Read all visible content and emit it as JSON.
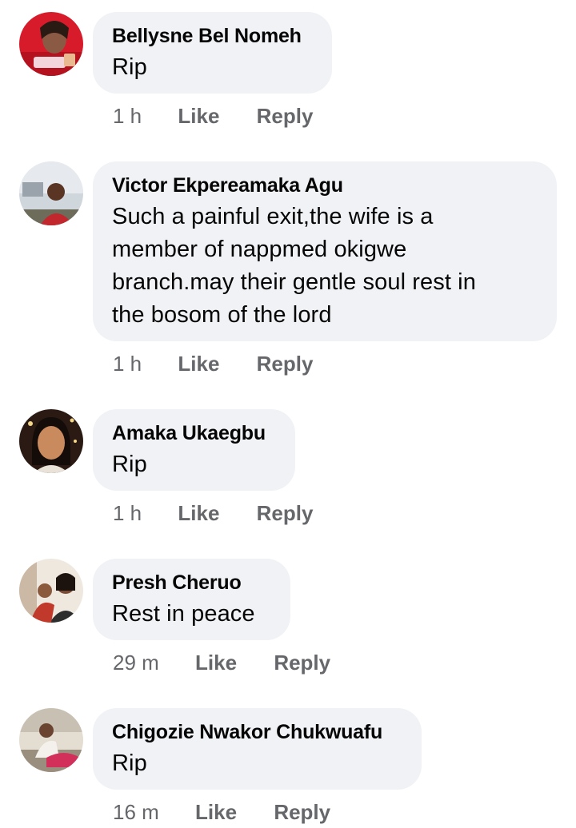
{
  "comments": [
    {
      "name": "Bellysne Bel Nomeh",
      "text": "Rip",
      "time": "1 h",
      "like": "Like",
      "reply": "Reply"
    },
    {
      "name": "Victor Ekpereamaka Agu",
      "text": "Such a painful exit,the wife is a member of nappmed okigwe branch.may their gentle soul rest in the bosom of the lord",
      "text_lines": [
        "Such a painful exit,the wife is a",
        "member of nappmed okigwe",
        "branch.may their gentle soul rest in",
        "the bosom of the lord"
      ],
      "time": "1 h",
      "like": "Like",
      "reply": "Reply"
    },
    {
      "name": "Amaka Ukaegbu",
      "text": "Rip",
      "time": "1 h",
      "like": "Like",
      "reply": "Reply"
    },
    {
      "name": "Presh Cheruo",
      "text": "Rest in peace",
      "time": "29 m",
      "like": "Like",
      "reply": "Reply"
    },
    {
      "name": "Chigozie Nwakor Chukwuafu",
      "text": "Rip",
      "time": "16 m",
      "like": "Like",
      "reply": "Reply"
    }
  ],
  "colors": {
    "bubble_bg": "#f0f2f5",
    "name_text": "#050505",
    "meta_text": "#65676b",
    "page_bg": "#ffffff"
  }
}
